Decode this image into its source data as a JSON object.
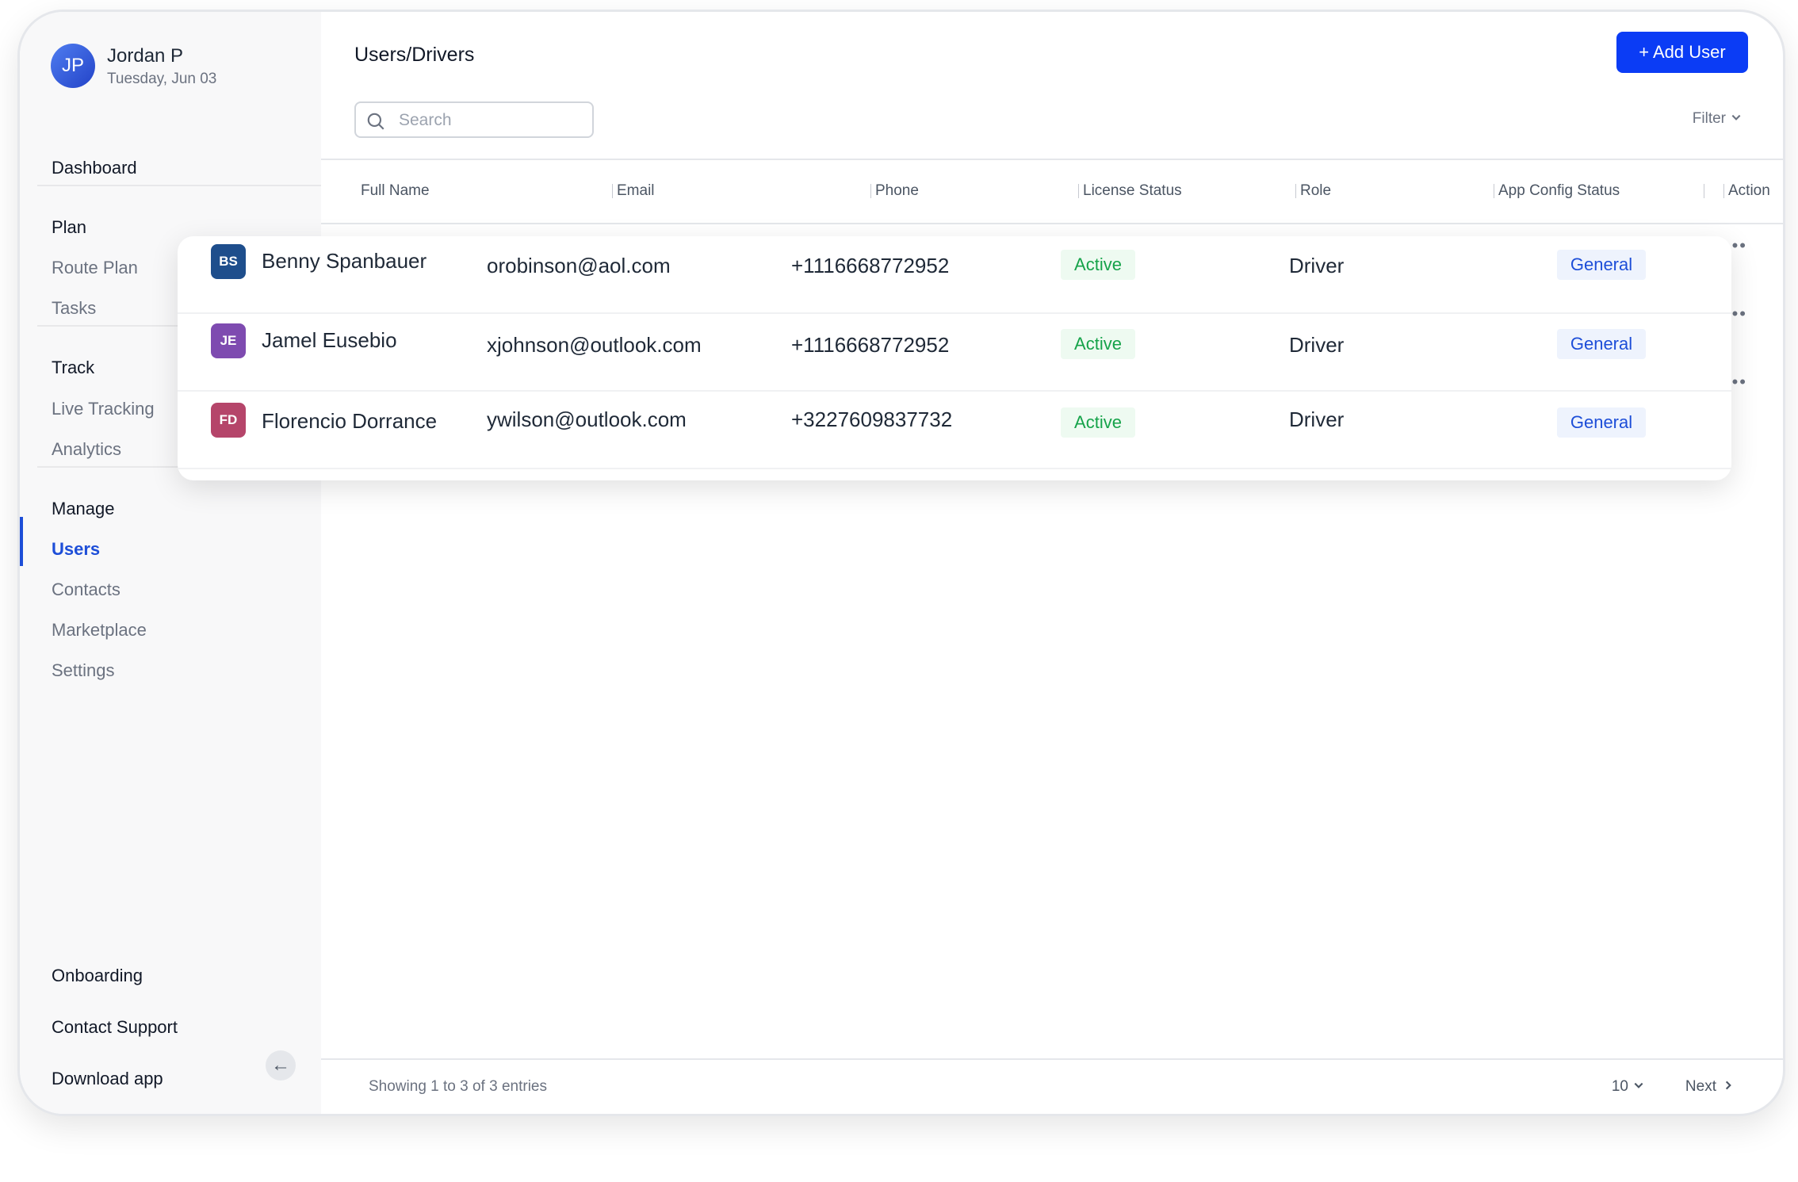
{
  "user": {
    "initials": "JP",
    "name": "Jordan P",
    "date": "Tuesday, Jun 03"
  },
  "nav": {
    "dashboard": "Dashboard",
    "plan": "Plan",
    "route_plan": "Route Plan",
    "tasks": "Tasks",
    "track": "Track",
    "live_tracking": "Live Tracking",
    "analytics": "Analytics",
    "manage": "Manage",
    "users": "Users",
    "contacts": "Contacts",
    "marketplace": "Marketplace",
    "settings": "Settings",
    "onboarding": "Onboarding",
    "contact_support": "Contact Support",
    "download_app": "Download app"
  },
  "header": {
    "title": "Users/Drivers",
    "add_user": "+ Add User"
  },
  "search": {
    "placeholder": "Search",
    "value": ""
  },
  "filter": {
    "label": "Filter"
  },
  "table": {
    "columns": [
      "Full Name",
      "Email",
      "Phone",
      "License Status",
      "Role",
      "App Config Status",
      "Action"
    ],
    "rows": [
      {
        "initials": "BS",
        "avatar_color": "#1e4e8c",
        "name": "Benny Spanbauer",
        "email": "orobinson@aol.com",
        "phone": "+1116668772952",
        "license": "Active",
        "role": "Driver",
        "config": "General"
      },
      {
        "initials": "JE",
        "avatar_color": "#7e4bb0",
        "name": "Jamel Eusebio",
        "email": "xjohnson@outlook.com",
        "phone": "+1116668772952",
        "license": "Active",
        "role": "Driver",
        "config": "General"
      },
      {
        "initials": "FD",
        "avatar_color": "#b5456a",
        "name": "Florencio Dorrance",
        "email": "ywilson@outlook.com",
        "phone": "+3227609837732",
        "license": "Active",
        "role": "Driver",
        "config": "General"
      }
    ]
  },
  "footer": {
    "showing": "Showing 1 to 3 of 3 entries",
    "page_size": "10",
    "next": "Next"
  },
  "colors": {
    "accent": "#0b3cf5",
    "active_nav": "#1d4ed8",
    "license_active": "#16a34a",
    "config_badge": "#1d4ed8"
  }
}
